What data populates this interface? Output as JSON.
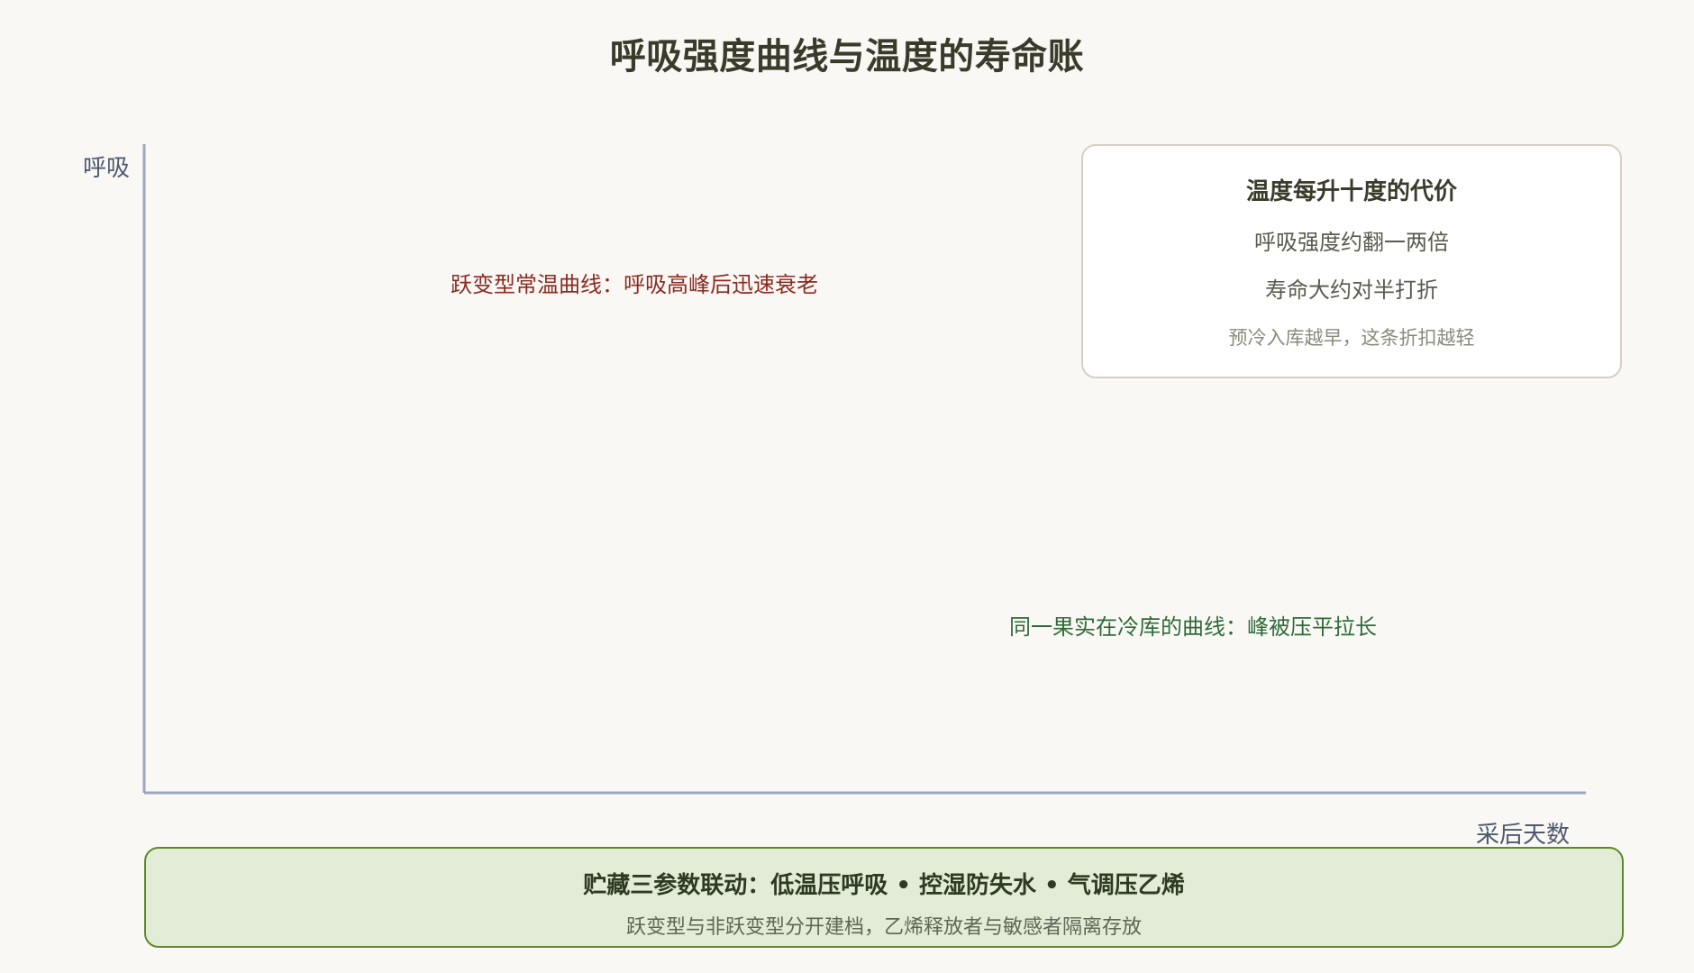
{
  "title": "呼吸强度曲线与温度的寿命账",
  "axes": {
    "y_label": "呼吸",
    "x_label": "采后天数",
    "axis_color": "#9aa8bd"
  },
  "curves": {
    "ambient_label": "跃变型常温曲线：呼吸高峰后迅速衰老",
    "ambient_color": "#8a2b22",
    "cold_label": "同一果实在冷库的曲线：峰被压平拉长",
    "cold_color": "#2f6b3a"
  },
  "cost_box": {
    "title": "温度每升十度的代价",
    "line1": "呼吸强度约翻一两倍",
    "line2": "寿命大约对半打折",
    "note": "预冷入库越早，这条折扣越轻"
  },
  "storage_box": {
    "title": "贮藏三参数联动：低温压呼吸 • 控湿防失水 • 气调压乙烯",
    "subtitle": "跃变型与非跃变型分开建档，乙烯释放者与敏感者隔离存放",
    "fill_color": "#e2ecd6",
    "border_color": "#5b8a2e"
  }
}
